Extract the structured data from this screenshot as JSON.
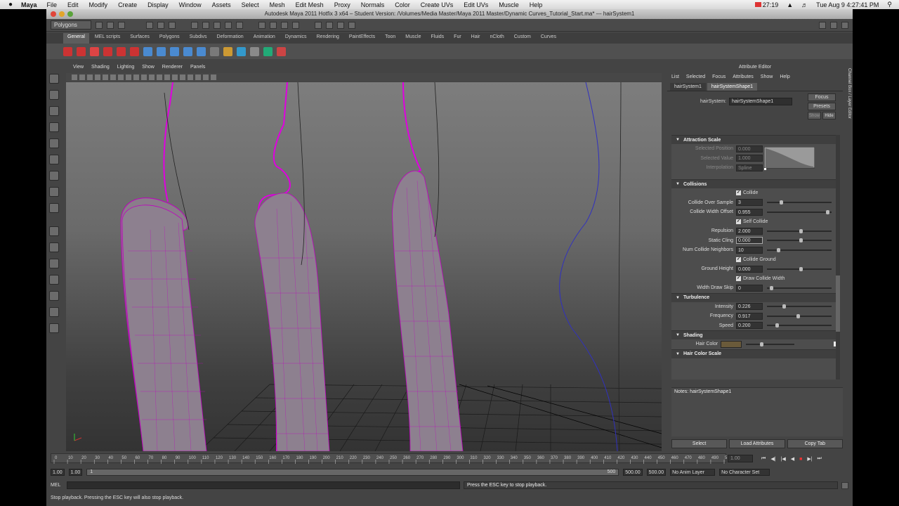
{
  "mac_menu": {
    "apple": "",
    "app_name": "Maya",
    "items": [
      "File",
      "Edit",
      "Modify",
      "Create",
      "Display",
      "Window",
      "Assets",
      "Select",
      "Mesh",
      "Edit Mesh",
      "Proxy",
      "Normals",
      "Color",
      "Create UVs",
      "Edit UVs",
      "Muscle",
      "Help"
    ],
    "battery_time": "27:19",
    "clock": "Tue Aug 9  4:27:41 PM"
  },
  "window": {
    "title": "Autodesk Maya 2011 Hotfix 3 x64 – Student Version: /Volumes/Media Master/Maya 2011 Master/Dynamic Curves_Tutorial_Start.ma*  ---  hairSystem1"
  },
  "statusline": {
    "menu_set": "Polygons"
  },
  "shelf": {
    "tabs": [
      "General",
      "MEL scripts",
      "Surfaces",
      "Polygons",
      "Subdivs",
      "Deformation",
      "Animation",
      "Dynamics",
      "Rendering",
      "PaintEffects",
      "Toon",
      "Muscle",
      "Fluids",
      "Fur",
      "Hair",
      "nCloth",
      "Custom",
      "Curves"
    ],
    "active_tab": "General"
  },
  "viewport_panel": {
    "menus": [
      "View",
      "Shading",
      "Lighting",
      "Show",
      "Renderer",
      "Panels"
    ]
  },
  "attribute_editor": {
    "title": "Attribute Editor",
    "menus": [
      "List",
      "Selected",
      "Focus",
      "Attributes",
      "Show",
      "Help"
    ],
    "tabs": [
      "hairSystem1",
      "hairSystemShape1"
    ],
    "active_tab": "hairSystemShape1",
    "node_label": "hairSystem:",
    "node_value": "hairSystemShape1",
    "buttons": [
      "Focus",
      "Presets",
      "Show",
      "Hide"
    ],
    "attraction_scale": {
      "header": "Attraction Scale",
      "selected_position_label": "Selected Position",
      "selected_position": "0.000",
      "selected_value_label": "Selected Value",
      "selected_value": "1.000",
      "interpolation_label": "Interpolation",
      "interpolation": "Spline"
    },
    "collisions": {
      "header": "Collisions",
      "collide_label": "Collide",
      "collide_over_sample_label": "Collide Over Sample",
      "collide_over_sample": "3",
      "collide_width_offset_label": "Collide Width Offset",
      "collide_width_offset": "0.955",
      "self_collide_label": "Self Collide",
      "repulsion_label": "Repulsion",
      "repulsion": "2.000",
      "static_cling_label": "Static Cling",
      "static_cling": "0.000",
      "num_collide_neighbors_label": "Num Collide Neighbors",
      "num_collide_neighbors": "10",
      "collide_ground_label": "Collide Ground",
      "ground_height_label": "Ground Height",
      "ground_height": "0.000",
      "draw_collide_width_label": "Draw Collide Width",
      "width_draw_skip_label": "Width Draw Skip",
      "width_draw_skip": "0"
    },
    "turbulence": {
      "header": "Turbulence",
      "intensity_label": "Intensity",
      "intensity": "0.226",
      "frequency_label": "Frequency",
      "frequency": "0.917",
      "speed_label": "Speed",
      "speed": "0.200"
    },
    "shading": {
      "header": "Shading",
      "hair_color_label": "Hair Color",
      "hair_color_swatch": "#6a5a3a",
      "hair_color_scale_header": "Hair Color Scale"
    },
    "notes_label": "Notes:  hairSystemShape1",
    "bottom_buttons": [
      "Select",
      "Load Attributes",
      "Copy Tab"
    ]
  },
  "time_slider": {
    "ticks": [
      "0",
      "10",
      "20",
      "30",
      "40",
      "50",
      "60",
      "70",
      "80",
      "90",
      "100",
      "110",
      "120",
      "130",
      "140",
      "150",
      "160",
      "170",
      "180",
      "190",
      "200",
      "210",
      "220",
      "230",
      "240",
      "250",
      "260",
      "270",
      "280",
      "290",
      "300",
      "310",
      "320",
      "330",
      "340",
      "350",
      "360",
      "370",
      "380",
      "390",
      "400",
      "410",
      "420",
      "430",
      "440",
      "450",
      "460",
      "470",
      "480",
      "490",
      "500"
    ],
    "current_frame": "1.00"
  },
  "range_slider": {
    "start": "1.00",
    "playback_start": "1.00",
    "range_start_marker": "1",
    "range_end_marker": "500",
    "playback_end": "500.00",
    "end": "500.00",
    "anim_layer": "No Anim Layer",
    "character_set": "No Character Set"
  },
  "command_line": {
    "label": "MEL",
    "result": "Press the ESC key to stop playback."
  },
  "help_line": "Stop playback.  Pressing the ESC key will also stop playback.",
  "colors": {
    "hair_magenta": "#d000d0",
    "curve_blue": "#3030c0",
    "maya_bg": "#444444"
  }
}
